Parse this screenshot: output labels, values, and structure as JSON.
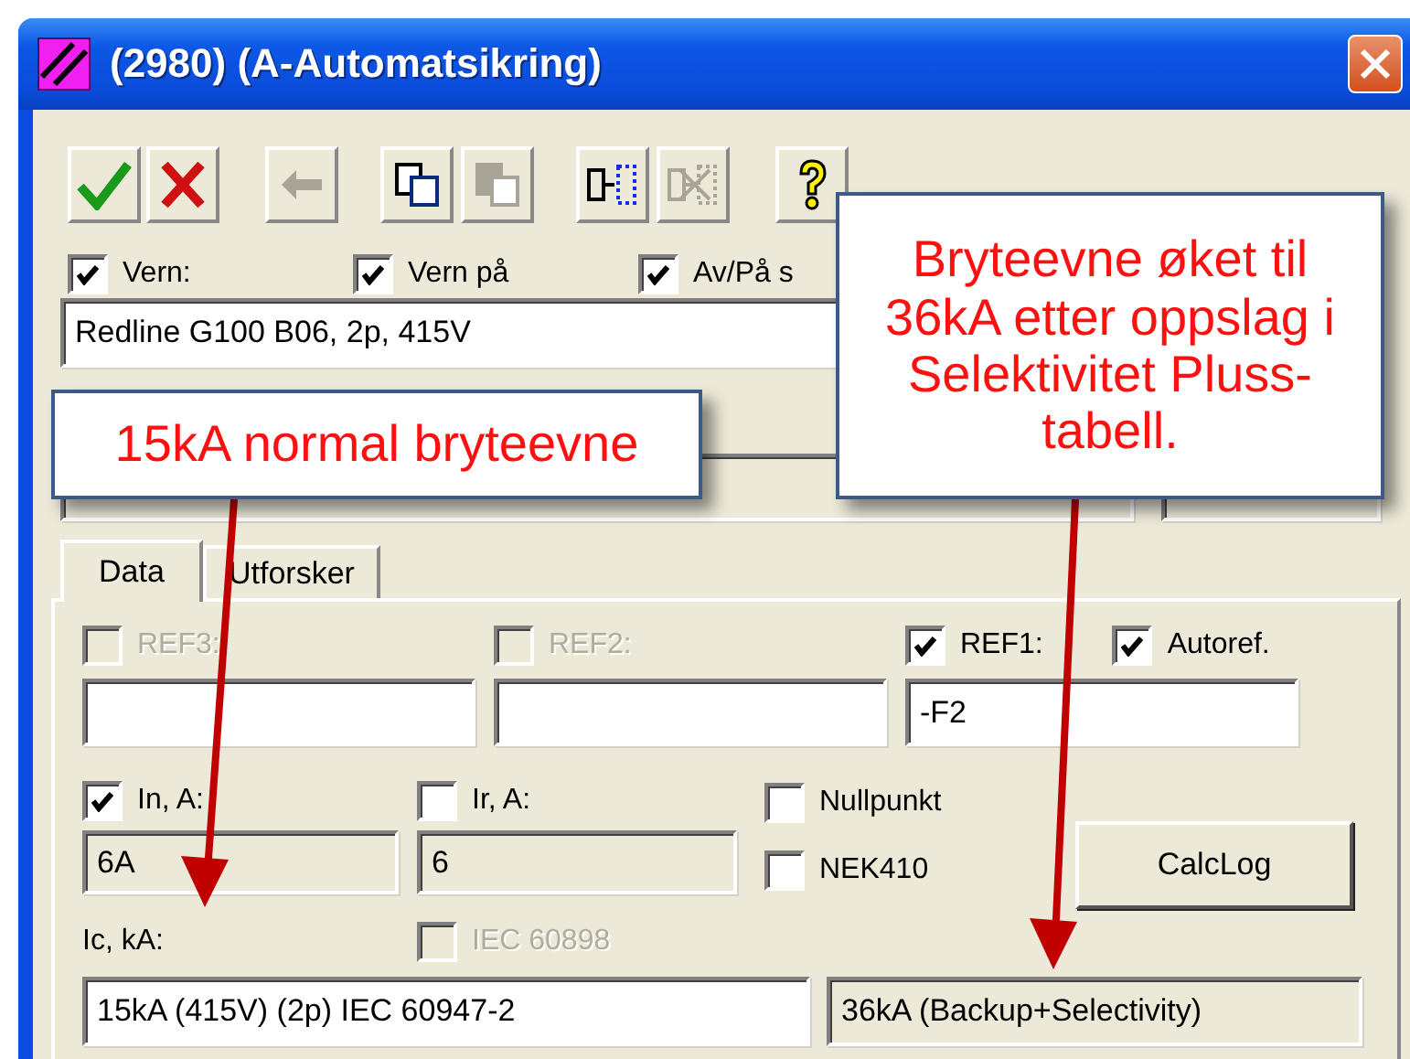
{
  "window": {
    "title": "(2980) (A-Automatsikring)"
  },
  "toolbar": [
    {
      "kind": "ok",
      "disabled": false
    },
    {
      "kind": "cancel",
      "disabled": false
    },
    {
      "kind": "back",
      "disabled": true
    },
    {
      "kind": "copy",
      "disabled": false
    },
    {
      "kind": "paste",
      "disabled": true
    },
    {
      "kind": "insert",
      "disabled": false
    },
    {
      "kind": "remove",
      "disabled": true
    },
    {
      "kind": "help",
      "disabled": false
    }
  ],
  "options": [
    {
      "label": "Vern:",
      "checked": true
    },
    {
      "label": "Vern på",
      "checked": true
    },
    {
      "label": "Av/På s",
      "checked": true
    }
  ],
  "device_field": {
    "value": "Redline G100 B06, 2p, 415V"
  },
  "tabs": [
    {
      "label": "Data",
      "selected": true
    },
    {
      "label": "Utforsker",
      "selected": false
    }
  ],
  "ref_fields": [
    {
      "label": "REF3:",
      "checked": false,
      "disabled": true
    },
    {
      "label": "REF2:",
      "checked": false,
      "disabled": true
    },
    {
      "label": "REF1:",
      "checked": true,
      "disabled": false,
      "value": "-F2"
    }
  ],
  "autoref": {
    "label": "Autoref.",
    "checked": true
  },
  "current_fields": [
    {
      "label": "In, A:",
      "checked": true,
      "value": "6A"
    },
    {
      "label": "Ir, A:",
      "checked": false,
      "value": "6"
    }
  ],
  "flags": [
    {
      "label": "Nullpunkt",
      "checked": false
    },
    {
      "label": "NEK410",
      "checked": false
    }
  ],
  "calc_button": "CalcLog",
  "ic": {
    "label": "Ic, kA:",
    "value": "15kA (415V) (2p) IEC 60947-2",
    "result": "36kA (Backup+Selectivity)"
  },
  "iec_option": {
    "label": "IEC 60898",
    "checked": false,
    "disabled": true
  },
  "callouts": [
    {
      "lines": [
        "15kA normal bryteevne"
      ]
    },
    {
      "lines": [
        "Bryteevne øket til",
        "36kA etter oppslag i",
        "Selektivitet Pluss-",
        "tabell."
      ]
    }
  ]
}
